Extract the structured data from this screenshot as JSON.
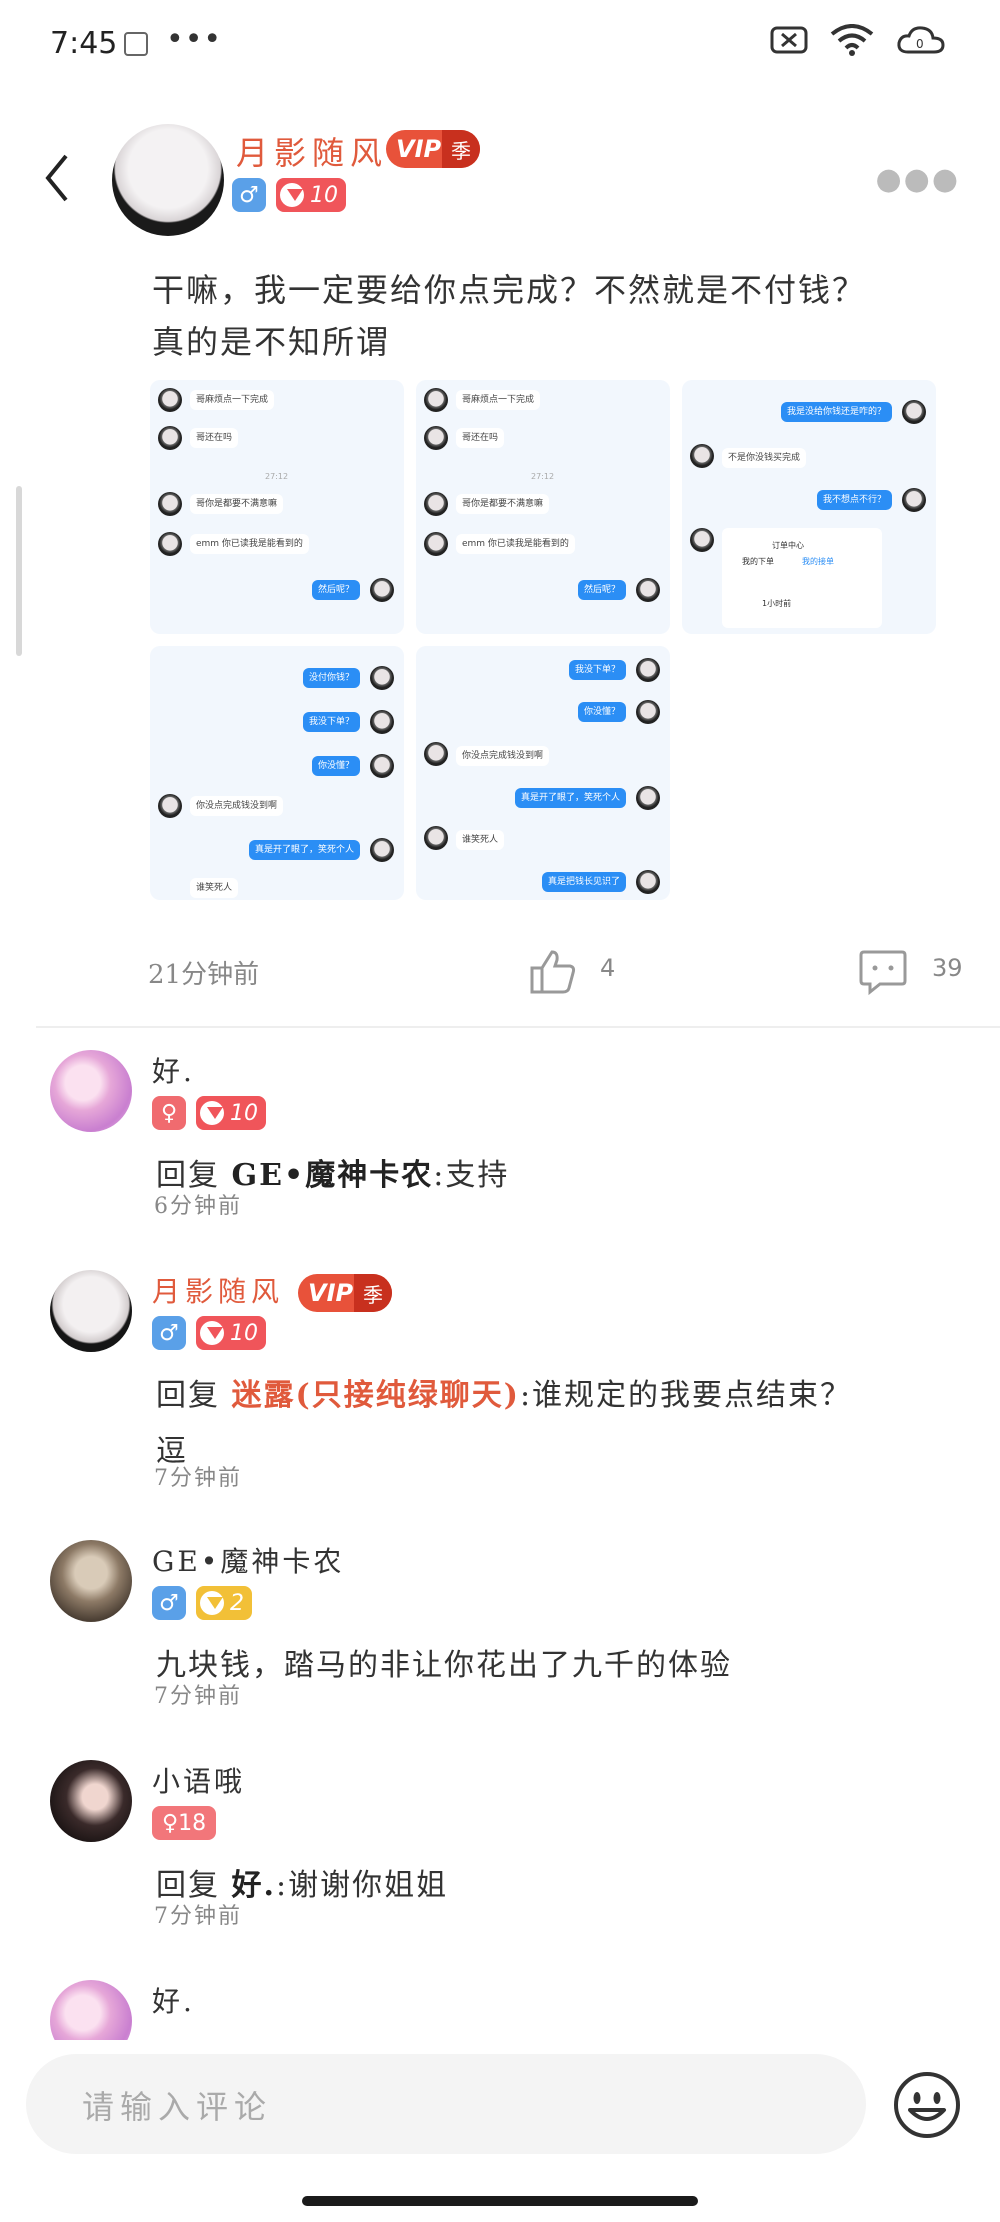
{
  "status_bar": {
    "time": "7:45",
    "more": "•••"
  },
  "post": {
    "author": "月影随风",
    "vip_label": "VIP",
    "vip_tier": "季",
    "gender": "♂",
    "level": "10",
    "text_line1": "干嘛，我一定要给你点完成？不然就是不付钱？",
    "text_line2": "真的是不知所谓",
    "time": "21分钟前",
    "likes": "4",
    "comments": "39",
    "screenshots": [
      {
        "messages": [
          "哥麻烦点一下完成",
          "哥还在吗",
          "27:12",
          "哥你是都要不满意嘛",
          "emm 你已读我是能看到的",
          "然后呢？"
        ]
      },
      {
        "messages": [
          "哥麻烦点一下完成",
          "哥还在吗",
          "27:12",
          "哥你是都要不满意嘛",
          "emm 你已读我是能看到的",
          "然后呢？"
        ]
      },
      {
        "messages": [
          "我是没给你钱还是咋的？",
          "不是你没钱买完成",
          "我不想点不行？",
          "订单中心",
          "我的下单",
          "我的接单",
          "1小时前"
        ]
      },
      {
        "messages": [
          "没付你钱？",
          "我没下单？",
          "你没懂？",
          "你没点完成钱没到啊",
          "真是开了眼了，笑死个人",
          "谁笑死人"
        ]
      },
      {
        "messages": [
          "我没下单？",
          "你没懂？",
          "你没点完成钱没到啊",
          "真是开了眼了，笑死个人",
          "谁笑死人",
          "真是把钱长见识了"
        ]
      }
    ]
  },
  "comments": [
    {
      "name": "好.",
      "gender": "♀",
      "level": "10",
      "reply_prefix": "回复",
      "reply_to": "GE•魔神卡农",
      "text": ":支持",
      "time": "6分钟前"
    },
    {
      "name": "月影随风",
      "vip_label": "VIP",
      "vip_tier": "季",
      "gender": "♂",
      "level": "10",
      "reply_prefix": "回复",
      "reply_to": "迷露(只接纯绿聊天)",
      "text": ":谁规定的我要点结束？",
      "text2": "逗",
      "time": "7分钟前"
    },
    {
      "name": "GE•魔神卡农",
      "gender": "♂",
      "level": "2",
      "text": "九块钱，踏马的非让你花出了九千的体验",
      "time": "7分钟前"
    },
    {
      "name": "小语哦",
      "gender_level": "♀18",
      "reply_prefix": "回复",
      "reply_to": "好.",
      "text": ":谢谢你姐姐",
      "time": "7分钟前"
    },
    {
      "name": "好."
    }
  ],
  "input": {
    "placeholder": "请输入评论"
  },
  "colors": {
    "accent_red": "#e05a3c",
    "male_blue": "#5aa0e8",
    "female_pink": "#f06b6f"
  }
}
